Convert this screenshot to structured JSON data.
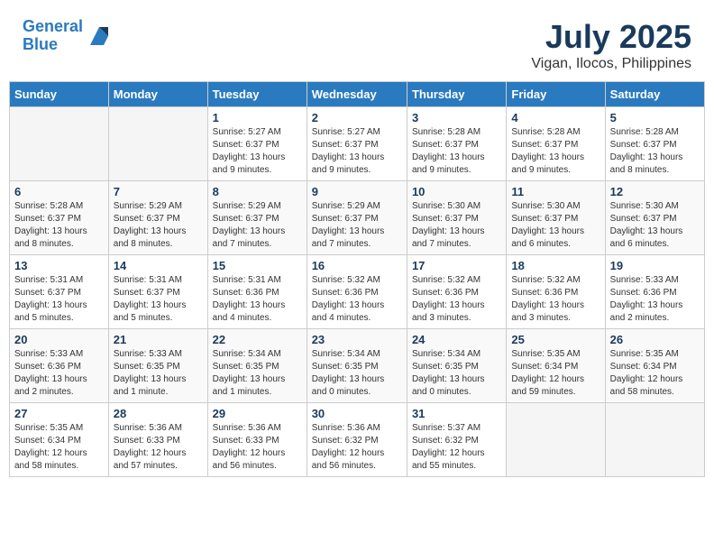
{
  "header": {
    "logo_line1": "General",
    "logo_line2": "Blue",
    "month": "July 2025",
    "location": "Vigan, Ilocos, Philippines"
  },
  "weekdays": [
    "Sunday",
    "Monday",
    "Tuesday",
    "Wednesday",
    "Thursday",
    "Friday",
    "Saturday"
  ],
  "weeks": [
    [
      {
        "day": "",
        "info": ""
      },
      {
        "day": "",
        "info": ""
      },
      {
        "day": "1",
        "info": "Sunrise: 5:27 AM\nSunset: 6:37 PM\nDaylight: 13 hours\nand 9 minutes."
      },
      {
        "day": "2",
        "info": "Sunrise: 5:27 AM\nSunset: 6:37 PM\nDaylight: 13 hours\nand 9 minutes."
      },
      {
        "day": "3",
        "info": "Sunrise: 5:28 AM\nSunset: 6:37 PM\nDaylight: 13 hours\nand 9 minutes."
      },
      {
        "day": "4",
        "info": "Sunrise: 5:28 AM\nSunset: 6:37 PM\nDaylight: 13 hours\nand 9 minutes."
      },
      {
        "day": "5",
        "info": "Sunrise: 5:28 AM\nSunset: 6:37 PM\nDaylight: 13 hours\nand 8 minutes."
      }
    ],
    [
      {
        "day": "6",
        "info": "Sunrise: 5:28 AM\nSunset: 6:37 PM\nDaylight: 13 hours\nand 8 minutes."
      },
      {
        "day": "7",
        "info": "Sunrise: 5:29 AM\nSunset: 6:37 PM\nDaylight: 13 hours\nand 8 minutes."
      },
      {
        "day": "8",
        "info": "Sunrise: 5:29 AM\nSunset: 6:37 PM\nDaylight: 13 hours\nand 7 minutes."
      },
      {
        "day": "9",
        "info": "Sunrise: 5:29 AM\nSunset: 6:37 PM\nDaylight: 13 hours\nand 7 minutes."
      },
      {
        "day": "10",
        "info": "Sunrise: 5:30 AM\nSunset: 6:37 PM\nDaylight: 13 hours\nand 7 minutes."
      },
      {
        "day": "11",
        "info": "Sunrise: 5:30 AM\nSunset: 6:37 PM\nDaylight: 13 hours\nand 6 minutes."
      },
      {
        "day": "12",
        "info": "Sunrise: 5:30 AM\nSunset: 6:37 PM\nDaylight: 13 hours\nand 6 minutes."
      }
    ],
    [
      {
        "day": "13",
        "info": "Sunrise: 5:31 AM\nSunset: 6:37 PM\nDaylight: 13 hours\nand 5 minutes."
      },
      {
        "day": "14",
        "info": "Sunrise: 5:31 AM\nSunset: 6:37 PM\nDaylight: 13 hours\nand 5 minutes."
      },
      {
        "day": "15",
        "info": "Sunrise: 5:31 AM\nSunset: 6:36 PM\nDaylight: 13 hours\nand 4 minutes."
      },
      {
        "day": "16",
        "info": "Sunrise: 5:32 AM\nSunset: 6:36 PM\nDaylight: 13 hours\nand 4 minutes."
      },
      {
        "day": "17",
        "info": "Sunrise: 5:32 AM\nSunset: 6:36 PM\nDaylight: 13 hours\nand 3 minutes."
      },
      {
        "day": "18",
        "info": "Sunrise: 5:32 AM\nSunset: 6:36 PM\nDaylight: 13 hours\nand 3 minutes."
      },
      {
        "day": "19",
        "info": "Sunrise: 5:33 AM\nSunset: 6:36 PM\nDaylight: 13 hours\nand 2 minutes."
      }
    ],
    [
      {
        "day": "20",
        "info": "Sunrise: 5:33 AM\nSunset: 6:36 PM\nDaylight: 13 hours\nand 2 minutes."
      },
      {
        "day": "21",
        "info": "Sunrise: 5:33 AM\nSunset: 6:35 PM\nDaylight: 13 hours\nand 1 minute."
      },
      {
        "day": "22",
        "info": "Sunrise: 5:34 AM\nSunset: 6:35 PM\nDaylight: 13 hours\nand 1 minutes."
      },
      {
        "day": "23",
        "info": "Sunrise: 5:34 AM\nSunset: 6:35 PM\nDaylight: 13 hours\nand 0 minutes."
      },
      {
        "day": "24",
        "info": "Sunrise: 5:34 AM\nSunset: 6:35 PM\nDaylight: 13 hours\nand 0 minutes."
      },
      {
        "day": "25",
        "info": "Sunrise: 5:35 AM\nSunset: 6:34 PM\nDaylight: 12 hours\nand 59 minutes."
      },
      {
        "day": "26",
        "info": "Sunrise: 5:35 AM\nSunset: 6:34 PM\nDaylight: 12 hours\nand 58 minutes."
      }
    ],
    [
      {
        "day": "27",
        "info": "Sunrise: 5:35 AM\nSunset: 6:34 PM\nDaylight: 12 hours\nand 58 minutes."
      },
      {
        "day": "28",
        "info": "Sunrise: 5:36 AM\nSunset: 6:33 PM\nDaylight: 12 hours\nand 57 minutes."
      },
      {
        "day": "29",
        "info": "Sunrise: 5:36 AM\nSunset: 6:33 PM\nDaylight: 12 hours\nand 56 minutes."
      },
      {
        "day": "30",
        "info": "Sunrise: 5:36 AM\nSunset: 6:32 PM\nDaylight: 12 hours\nand 56 minutes."
      },
      {
        "day": "31",
        "info": "Sunrise: 5:37 AM\nSunset: 6:32 PM\nDaylight: 12 hours\nand 55 minutes."
      },
      {
        "day": "",
        "info": ""
      },
      {
        "day": "",
        "info": ""
      }
    ]
  ]
}
